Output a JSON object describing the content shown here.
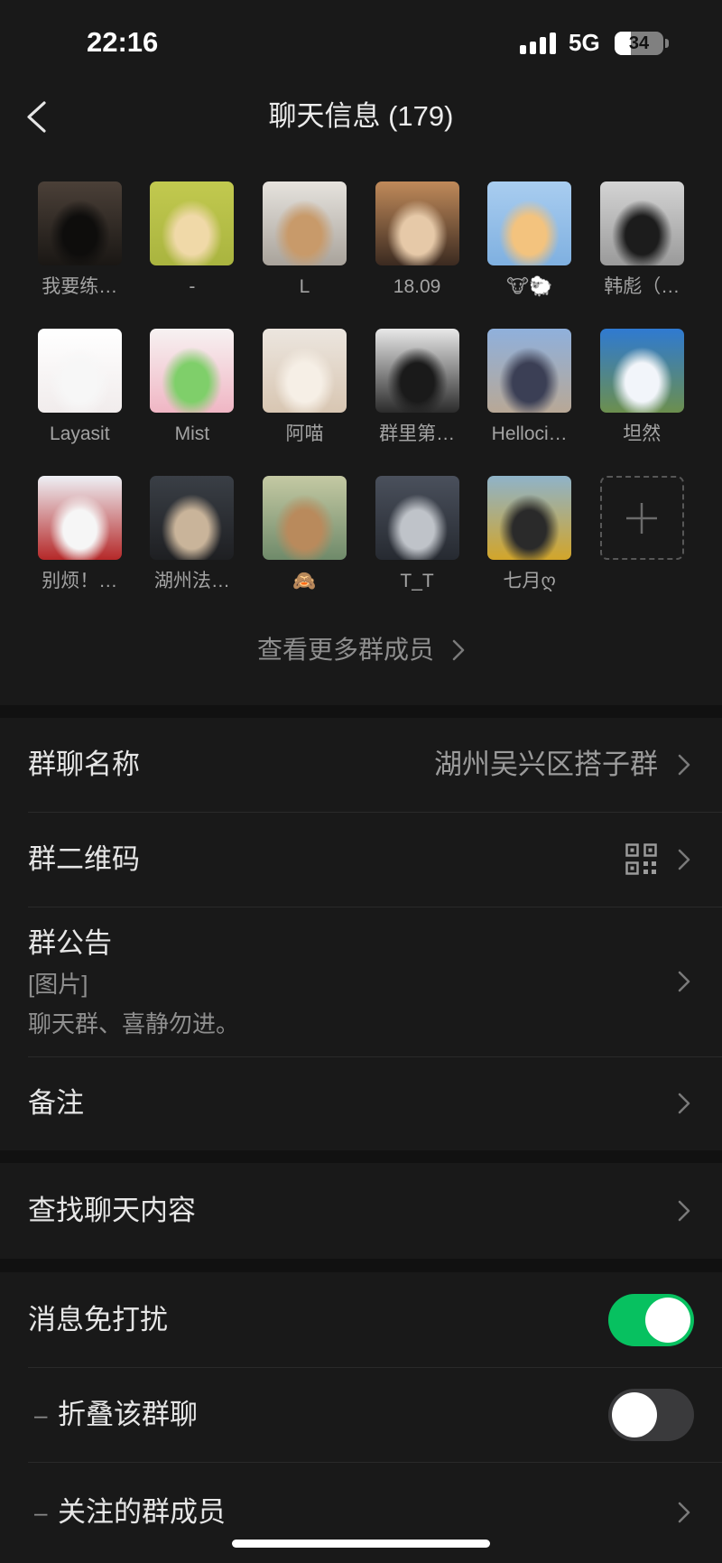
{
  "status_bar": {
    "time": "22:16",
    "network": "5G",
    "battery": "34",
    "icons": [
      "signal-icon",
      "battery-icon"
    ]
  },
  "header": {
    "title": "聊天信息 (179)",
    "back_icon": "chevron-left-icon"
  },
  "members": [
    {
      "name": "我要练…",
      "avatar_colors": [
        "#4b4038",
        "#1a1714",
        "#0e0d0c"
      ]
    },
    {
      "name": "-",
      "avatar_colors": [
        "#c2c94f",
        "#a9b43f",
        "#f0d9a8"
      ]
    },
    {
      "name": "L",
      "avatar_colors": [
        "#e6e3de",
        "#a9a39b",
        "#c89a6a"
      ]
    },
    {
      "name": "18.09",
      "avatar_colors": [
        "#c08a5a",
        "#3b2a20",
        "#e6c9a8"
      ]
    },
    {
      "name": "🐮🐑",
      "avatar_colors": [
        "#a9cdf0",
        "#7fb0e0",
        "#f3c37e"
      ]
    },
    {
      "name": "韩彪（…",
      "avatar_colors": [
        "#d4d4d4",
        "#9a9a9a",
        "#1c1c1c"
      ]
    },
    {
      "name": "Layasit",
      "avatar_colors": [
        "#ffffff",
        "#f1ecec",
        "#f7f7f7"
      ]
    },
    {
      "name": "Mist",
      "avatar_colors": [
        "#f7f2f2",
        "#f0b6c4",
        "#7fcf6a"
      ]
    },
    {
      "name": "阿喵",
      "avatar_colors": [
        "#ece6df",
        "#d8c6b2",
        "#f6efe6"
      ]
    },
    {
      "name": "群里第…",
      "avatar_colors": [
        "#e8e8e8",
        "#2b2b2b",
        "#1a1a1a"
      ]
    },
    {
      "name": "Helloci…",
      "avatar_colors": [
        "#8fb0dc",
        "#b8a896",
        "#3b3f55"
      ]
    },
    {
      "name": "坦然",
      "avatar_colors": [
        "#2f7ad1",
        "#6c8f4e",
        "#f2f5fa"
      ]
    },
    {
      "name": "别烦！…",
      "avatar_colors": [
        "#eef0f5",
        "#b52828",
        "#f6f6f6"
      ]
    },
    {
      "name": "湖州法…",
      "avatar_colors": [
        "#3a3f46",
        "#1e1f22",
        "#c9b49a"
      ]
    },
    {
      "name": "🙈",
      "avatar_colors": [
        "#c4c9a3",
        "#6f8a6a",
        "#b98a5c"
      ]
    },
    {
      "name": "T_T",
      "avatar_colors": [
        "#4a505c",
        "#262a31",
        "#bfc3c9"
      ]
    },
    {
      "name": "七月ღ",
      "avatar_colors": [
        "#8fb3c9",
        "#d2a52a",
        "#2a2a2a"
      ]
    }
  ],
  "add_member_icon": "plus-icon",
  "more_members_label": "查看更多群成员",
  "settings": {
    "group_name": {
      "label": "群聊名称",
      "value": "湖州吴兴区搭子群"
    },
    "qr_code": {
      "label": "群二维码",
      "icon": "qr-code-icon"
    },
    "notice": {
      "label": "群公告",
      "lines": [
        "[图片]",
        "聊天群、喜静勿进。"
      ]
    },
    "remark": {
      "label": "备注"
    },
    "search_history": {
      "label": "查找聊天内容"
    },
    "mute": {
      "label": "消息免打扰",
      "enabled": true
    },
    "fold": {
      "prefix": "–",
      "label": "折叠该群聊",
      "enabled": false
    },
    "followed_members": {
      "prefix": "–",
      "label": "关注的群成员"
    }
  },
  "colors": {
    "page_background": "#111111",
    "cell_background": "#191919",
    "text_primary": "#e6e6e6",
    "text_secondary": "#9b9b9b",
    "divider": "#2a2a2a",
    "toggle_on": "#07c160",
    "toggle_off": "#3a3a3c"
  }
}
